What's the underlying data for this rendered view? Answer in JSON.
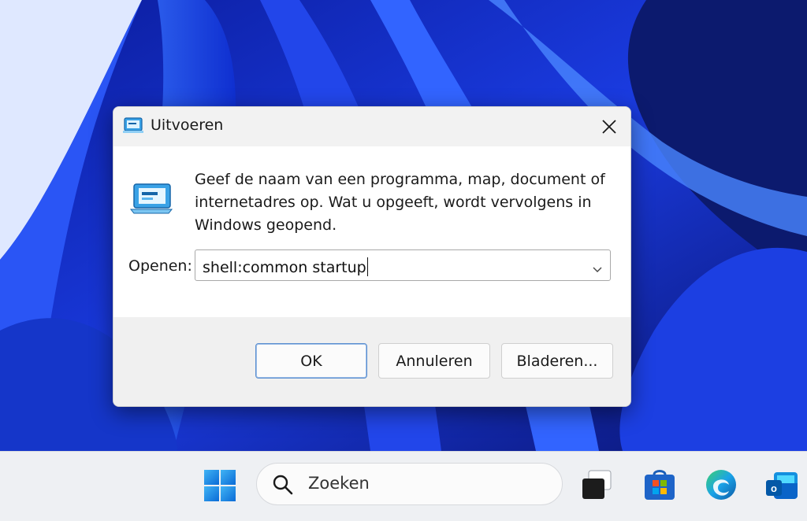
{
  "dialog": {
    "title": "Uitvoeren",
    "description": "Geef de naam van een programma, map, document of internetadres op. Wat u opgeeft, wordt vervolgens in Windows geopend.",
    "open_label": "Openen:",
    "open_value": "shell:common startup",
    "buttons": {
      "ok": "OK",
      "cancel": "Annuleren",
      "browse": "Bladeren..."
    }
  },
  "taskbar": {
    "search_placeholder": "Zoeken",
    "apps": [
      "windows-start-icon",
      "task-view-icon",
      "microsoft-store-icon",
      "edge-icon",
      "outlook-icon"
    ]
  },
  "colors": {
    "wallpaper_blue": "#1d3fe0",
    "accent": "#0067c0",
    "button_focus": "#5b8fd0"
  }
}
